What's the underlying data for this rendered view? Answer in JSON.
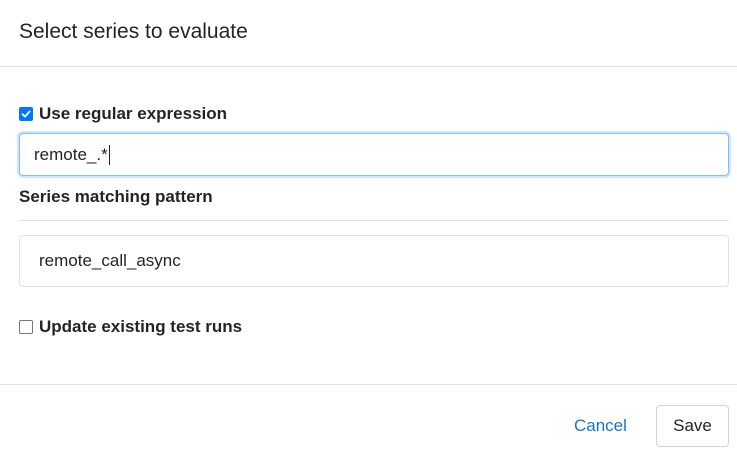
{
  "dialog": {
    "title": "Select series to evaluate"
  },
  "regex": {
    "checkbox_checked": true,
    "checkbox_label": "Use regular expression",
    "input_value": "remote_.*"
  },
  "matching": {
    "section_label": "Series matching pattern",
    "items": [
      "remote_call_async"
    ]
  },
  "update": {
    "checkbox_checked": false,
    "checkbox_label": "Update existing test runs"
  },
  "footer": {
    "cancel_label": "Cancel",
    "save_label": "Save"
  },
  "colors": {
    "accent": "#0075ff",
    "link": "#1a73c8",
    "focus_border": "#80bdff"
  }
}
